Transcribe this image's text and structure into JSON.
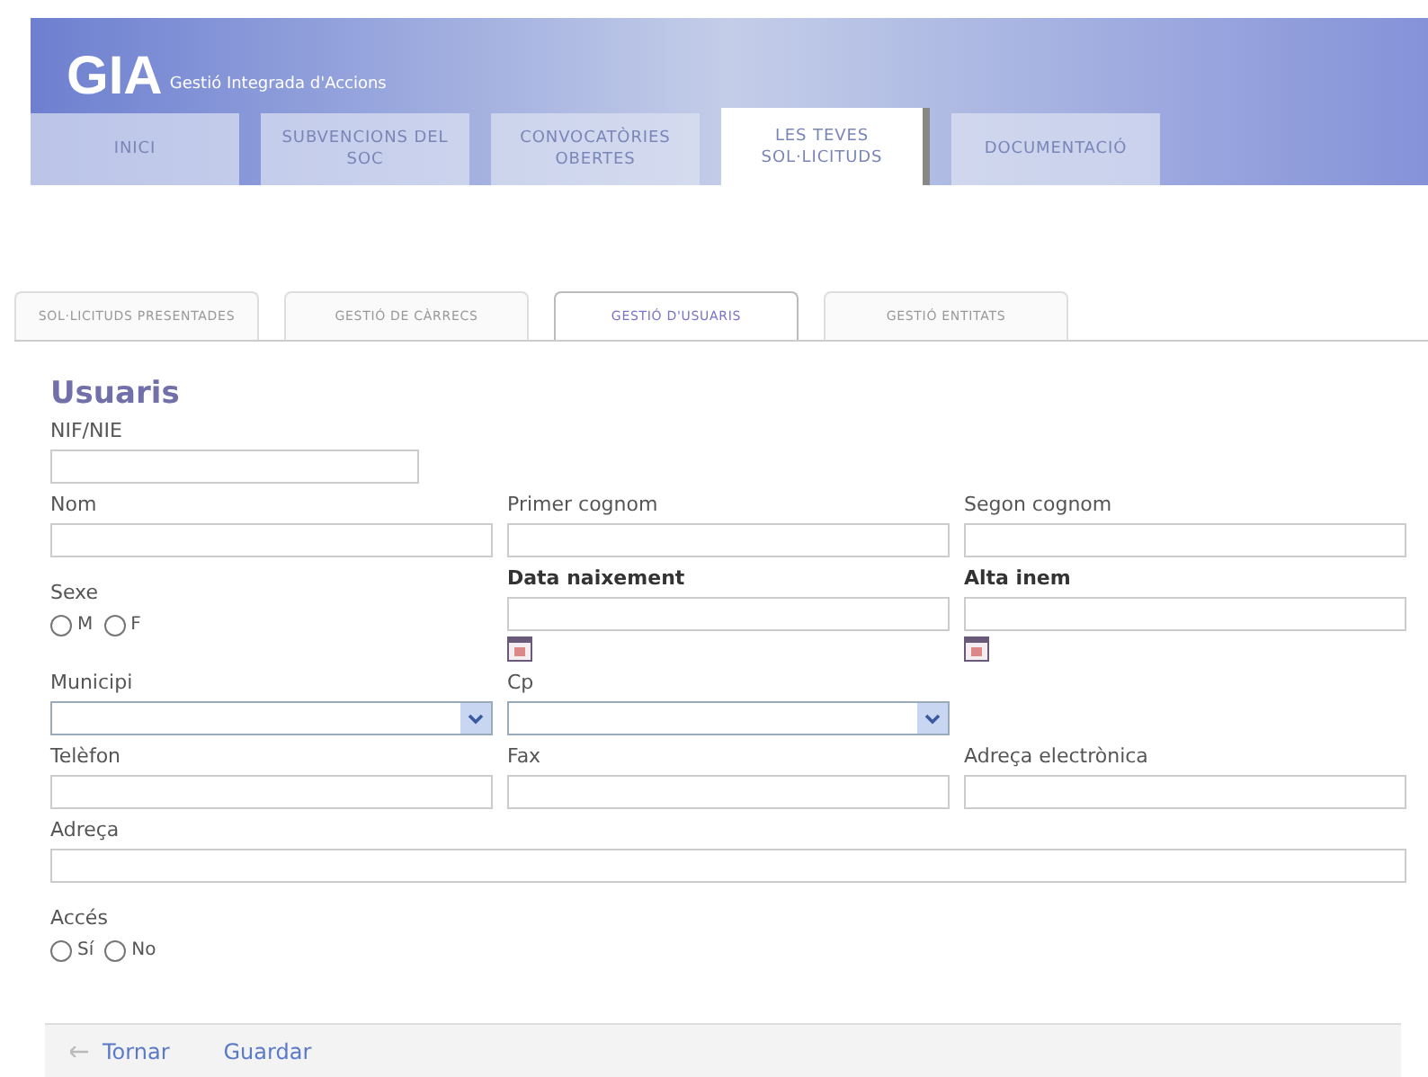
{
  "header": {
    "logo": "GIA",
    "subtitle": "Gestió Integrada d'Accions"
  },
  "nav_tabs": [
    {
      "label": "INICI",
      "selected": false
    },
    {
      "label": "SUBVENCIONS DEL SOC",
      "selected": false
    },
    {
      "label": "CONVOCATÒRIES OBERTES",
      "selected": false
    },
    {
      "label": "LES TEVES SOL·LICITUDS",
      "selected": true
    },
    {
      "label": "DOCUMENTACIÓ",
      "selected": false
    }
  ],
  "sub_tabs": [
    {
      "label": "SOL·LICITUDS PRESENTADES",
      "selected": false
    },
    {
      "label": "GESTIÓ DE CÀRRECS",
      "selected": false
    },
    {
      "label": "GESTIÓ D'USUARIS",
      "selected": true
    },
    {
      "label": "GESTIÓ ENTITATS",
      "selected": false
    }
  ],
  "form": {
    "title": "Usuaris",
    "rows": [
      [
        {
          "kind": "short_text",
          "label": "NIF/NIE"
        }
      ],
      [
        {
          "kind": "text",
          "label": "Nom"
        },
        {
          "kind": "text",
          "label": "Primer cognom"
        },
        {
          "kind": "text",
          "label": "Segon cognom"
        }
      ],
      [
        {
          "kind": "radio",
          "label": "Sexe",
          "options": [
            {
              "label": "M",
              "checked": false
            },
            {
              "label": "F",
              "checked": false
            }
          ]
        },
        {
          "kind": "date",
          "label": "Data naixement"
        },
        {
          "kind": "date",
          "label": "Alta inem"
        }
      ],
      [
        {
          "kind": "select",
          "label": "Municipi"
        },
        {
          "kind": "select",
          "label": "Cp"
        }
      ],
      [
        {
          "kind": "text",
          "label": "Telèfon"
        },
        {
          "kind": "text",
          "label": "Fax"
        },
        {
          "kind": "text",
          "label": "Adreça electrònica"
        }
      ],
      [
        {
          "kind": "long_text",
          "label": "Adreça"
        }
      ],
      [
        {
          "kind": "radio",
          "label": "Accés",
          "options": [
            {
              "label": "Sí",
              "checked": false
            },
            {
              "label": "No",
              "checked": false
            }
          ]
        }
      ]
    ]
  },
  "footer": {
    "back": "Tornar",
    "save": "Guardar"
  }
}
